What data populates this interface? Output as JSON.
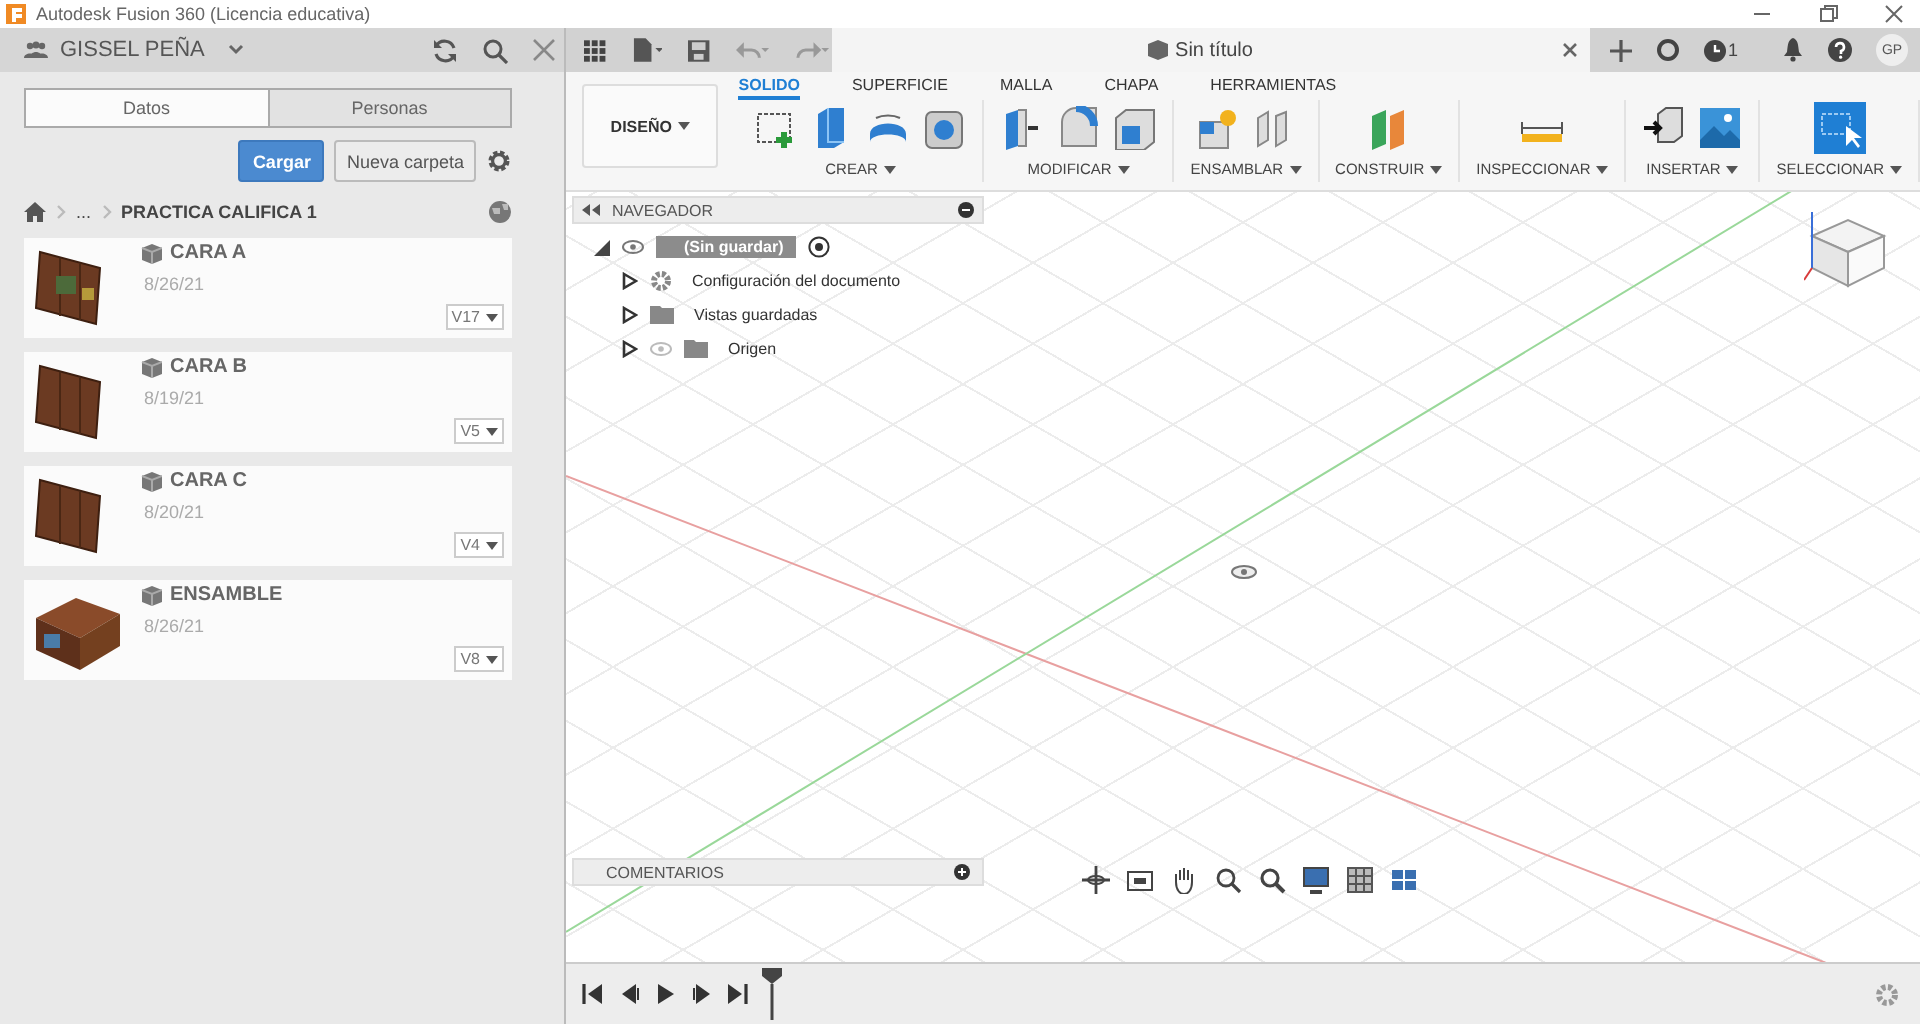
{
  "window": {
    "title": "Autodesk Fusion 360 (Licencia educativa)"
  },
  "data_panel": {
    "user": "GISSEL PEÑA",
    "tabs": [
      {
        "label": "Datos",
        "selected": true
      },
      {
        "label": "Personas",
        "selected": false
      }
    ],
    "upload_button": "Cargar",
    "new_folder_button": "Nueva carpeta",
    "breadcrumb": {
      "ellipsis": "...",
      "folder": "PRACTICA CALIFICA 1"
    },
    "files": [
      {
        "name": "CARA A",
        "date": "8/26/21",
        "version": "V17",
        "kind": "panel"
      },
      {
        "name": "CARA B",
        "date": "8/19/21",
        "version": "V5",
        "kind": "panel"
      },
      {
        "name": "CARA C",
        "date": "8/20/21",
        "version": "V4",
        "kind": "panel"
      },
      {
        "name": "ENSAMBLE",
        "date": "8/26/21",
        "version": "V8",
        "kind": "assembly"
      }
    ]
  },
  "document_tab": {
    "title": "Sin título"
  },
  "job_status": {
    "count": "1"
  },
  "avatar": "GP",
  "ribbon": {
    "workspace": "DISEÑO",
    "tabs": [
      {
        "label": "SOLIDO",
        "selected": true
      },
      {
        "label": "SUPERFICIE",
        "selected": false
      },
      {
        "label": "MALLA",
        "selected": false
      },
      {
        "label": "CHAPA",
        "selected": false
      },
      {
        "label": "HERRAMIENTAS",
        "selected": false
      }
    ],
    "groups": [
      "CREAR",
      "MODIFICAR",
      "ENSAMBLAR",
      "CONSTRUIR",
      "INSPECCIONAR",
      "INSERTAR",
      "SELECCIONAR"
    ]
  },
  "browser": {
    "title": "NAVEGADOR",
    "root": {
      "label": "(Sin guardar)",
      "children": [
        {
          "label": "Configuración del documento",
          "kind": "settings"
        },
        {
          "label": "Vistas guardadas",
          "kind": "folder"
        },
        {
          "label": "Origen",
          "kind": "origin"
        }
      ]
    }
  },
  "comments": {
    "title": "COMENTARIOS"
  }
}
